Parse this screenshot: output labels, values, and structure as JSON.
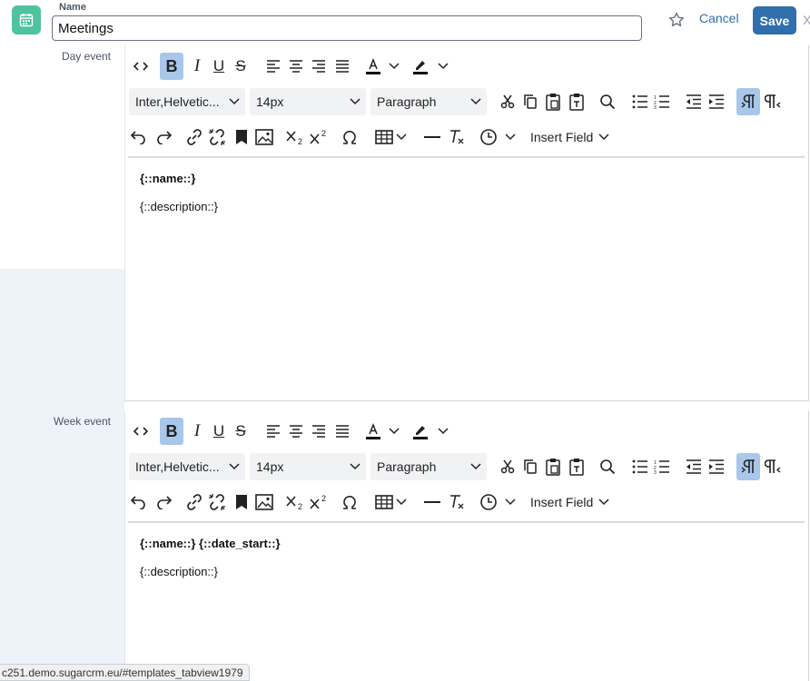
{
  "header": {
    "name_label": "Name",
    "name_value": "Meetings",
    "cancel_label": "Cancel",
    "save_label": "Save",
    "close_glyph": "X",
    "module_icon": "calendar-icon",
    "accent_color": "#2f6fae",
    "module_color": "#4fc2a0"
  },
  "editors": [
    {
      "label": "Day event",
      "toolbar": {
        "font_family": "Inter,Helvetic...",
        "font_size": "14px",
        "block_format": "Paragraph",
        "insert_field": "Insert Field"
      },
      "content": {
        "line1": "{::name::}",
        "line2": "{::description::}"
      }
    },
    {
      "label": "Week event",
      "toolbar": {
        "font_family": "Inter,Helvetic...",
        "font_size": "14px",
        "block_format": "Paragraph",
        "insert_field": "Insert Field"
      },
      "content": {
        "line1": "{::name::} {::date_start::}",
        "line2": "{::description::}"
      }
    }
  ],
  "status_bar": {
    "url": "c251.demo.sugarcrm.eu/#templates_tabview1979"
  }
}
